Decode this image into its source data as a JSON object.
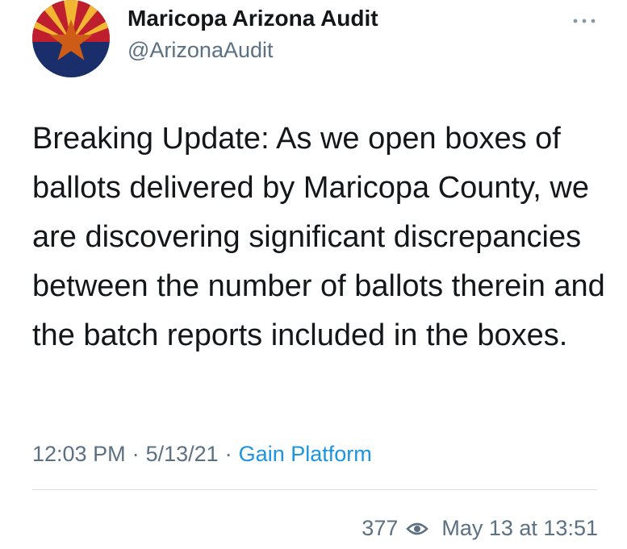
{
  "tweet": {
    "author_name": "Maricopa Arizona Audit",
    "author_handle": "@ArizonaAudit",
    "text": "Breaking Update: As we open boxes of ballots delivered by Maricopa County, we are discovering significant discrepancies between the number of ballots therein and the batch reports included in the boxes.",
    "time": "12:03 PM",
    "date": "5/13/21",
    "separator": "·",
    "source": "Gain Platform",
    "more_icon": "more-horizontal-icon",
    "avatar": "arizona-flag-avatar"
  },
  "footer": {
    "views": "377",
    "views_icon": "eye-icon",
    "timestamp": "May 13 at 13:51"
  },
  "colors": {
    "text": "#14171a",
    "secondary": "#5b7083",
    "link": "#1b95e0",
    "flag_red": "#bf1e2e",
    "flag_gold": "#f2b632",
    "flag_blue": "#1a2e6c",
    "flag_copper": "#ce5c17"
  }
}
